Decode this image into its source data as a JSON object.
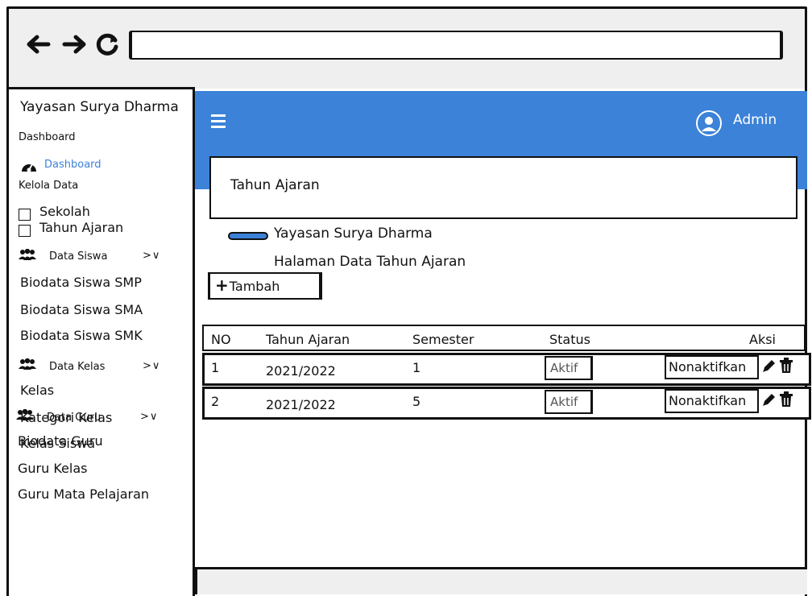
{
  "browser": {
    "back_icon": "←",
    "forward_icon": "→",
    "reload_icon": "↻",
    "url": ""
  },
  "sidebar": {
    "brand": "Yayasan Surya Dharma",
    "section_dashboard": "Dashboard",
    "dashboard_link": "Dashboard",
    "section_kelola": "Kelola Data",
    "items_kelola": [
      "Sekolah",
      "Tahun Ajaran"
    ],
    "group_siswa": {
      "label": "Data Siswa",
      "chevron": ">∨",
      "items": [
        "Biodata Siswa SMP",
        "Biodata Siswa SMA",
        "Biodata Siswa SMK"
      ]
    },
    "group_kelas": {
      "label": "Data Kelas",
      "chevron": ">∨",
      "items": [
        "Kelas",
        "Kategori Kelas",
        "Kelas Siswa"
      ]
    },
    "group_guru": {
      "label": "Data Guru",
      "chevron": ">∨",
      "items": [
        "Biodata Guru",
        "Guru Kelas",
        "Guru Mata Pelajaran"
      ]
    }
  },
  "topbar": {
    "user_label": "Admin",
    "accent": "#3b82d8"
  },
  "card": {
    "title": "Tahun Ajaran"
  },
  "breadcrumb": {
    "label": "Yayasan Surya Dharma"
  },
  "page": {
    "subtitle": "Halaman Data Tahun Ajaran",
    "add_button": "Tambah",
    "add_icon": "+"
  },
  "table": {
    "headers": [
      "NO",
      "Tahun Ajaran",
      "Semester",
      "Status",
      "Aksi"
    ],
    "rows": [
      {
        "no": "1",
        "tahun": "2021/2022",
        "semester": "1",
        "status": "Aktif",
        "action": "Nonaktifkan"
      },
      {
        "no": "2",
        "tahun": "2021/2022",
        "semester": "5",
        "status": "Aktif",
        "action": "Nonaktifkan"
      }
    ],
    "edit_icon": "✎",
    "delete_icon": "🗑"
  }
}
